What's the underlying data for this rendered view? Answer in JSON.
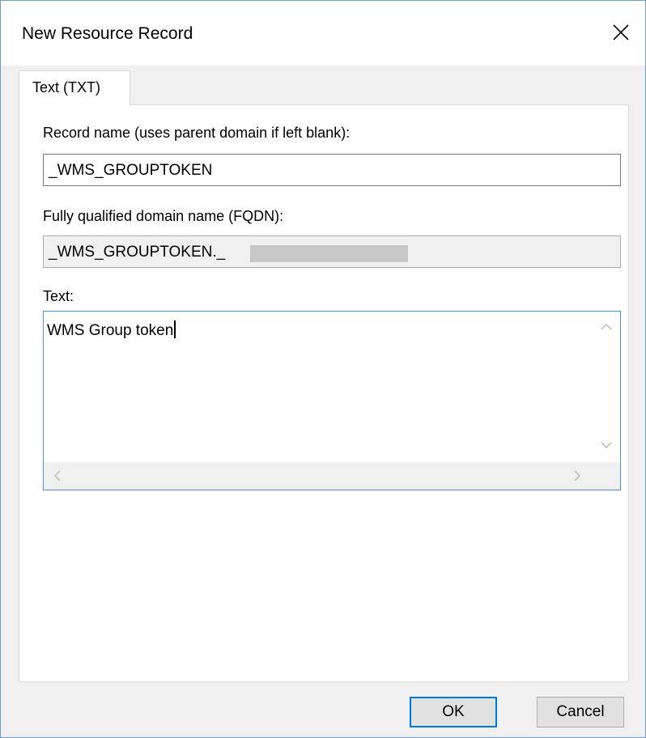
{
  "window": {
    "title": "New Resource Record",
    "close_icon": "close-icon"
  },
  "tabs": [
    {
      "label": "Text (TXT)",
      "selected": true
    }
  ],
  "form": {
    "record_name_label": "Record name (uses parent domain if left blank):",
    "record_name_value": "_WMS_GROUPTOKEN",
    "fqdn_label": "Fully qualified domain name (FQDN):",
    "fqdn_value": "_WMS_GROUPTOKEN._",
    "text_label": "Text:",
    "text_value": "WMS Group token"
  },
  "scrollbar_icons": [
    "chevron-up-icon",
    "chevron-down-icon",
    "chevron-left-icon",
    "chevron-right-icon"
  ],
  "buttons": {
    "ok_label": "OK",
    "cancel_label": "Cancel"
  },
  "colors": {
    "focus_border": "#4d8ede",
    "default_button_border": "#0078d7",
    "dialog_background": "#f0f0f0"
  }
}
